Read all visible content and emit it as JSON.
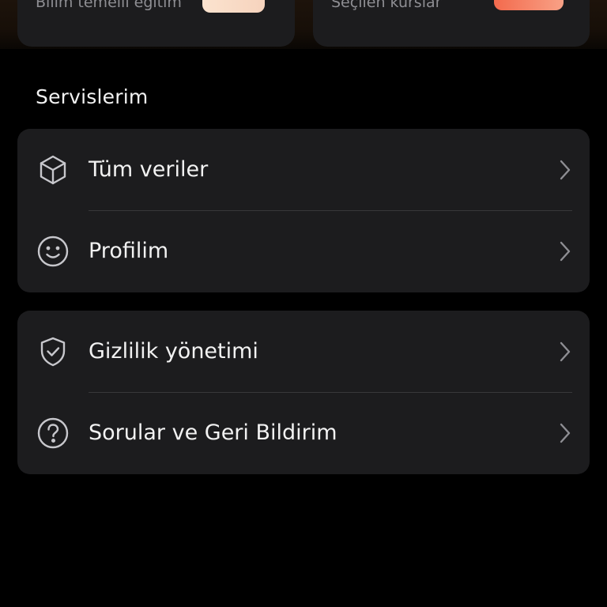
{
  "promo_cards": [
    {
      "text": "Bilim temelli eğitim"
    },
    {
      "text": "Seçilen kurslar"
    }
  ],
  "services": {
    "title": "Servislerim",
    "group1": [
      {
        "label": "Tüm veriler",
        "icon": "cube-icon"
      },
      {
        "label": "Profilim",
        "icon": "smiley-icon"
      }
    ],
    "group2": [
      {
        "label": "Gizlilik yönetimi",
        "icon": "shield-check-icon"
      },
      {
        "label": "Sorular ve Geri Bildirim",
        "icon": "question-circle-icon"
      }
    ]
  },
  "colors": {
    "background": "#000000",
    "card": "#1c1c1e",
    "text": "#f2f2f2",
    "icon": "#c7c7cc",
    "chevron": "#8e8e93"
  }
}
